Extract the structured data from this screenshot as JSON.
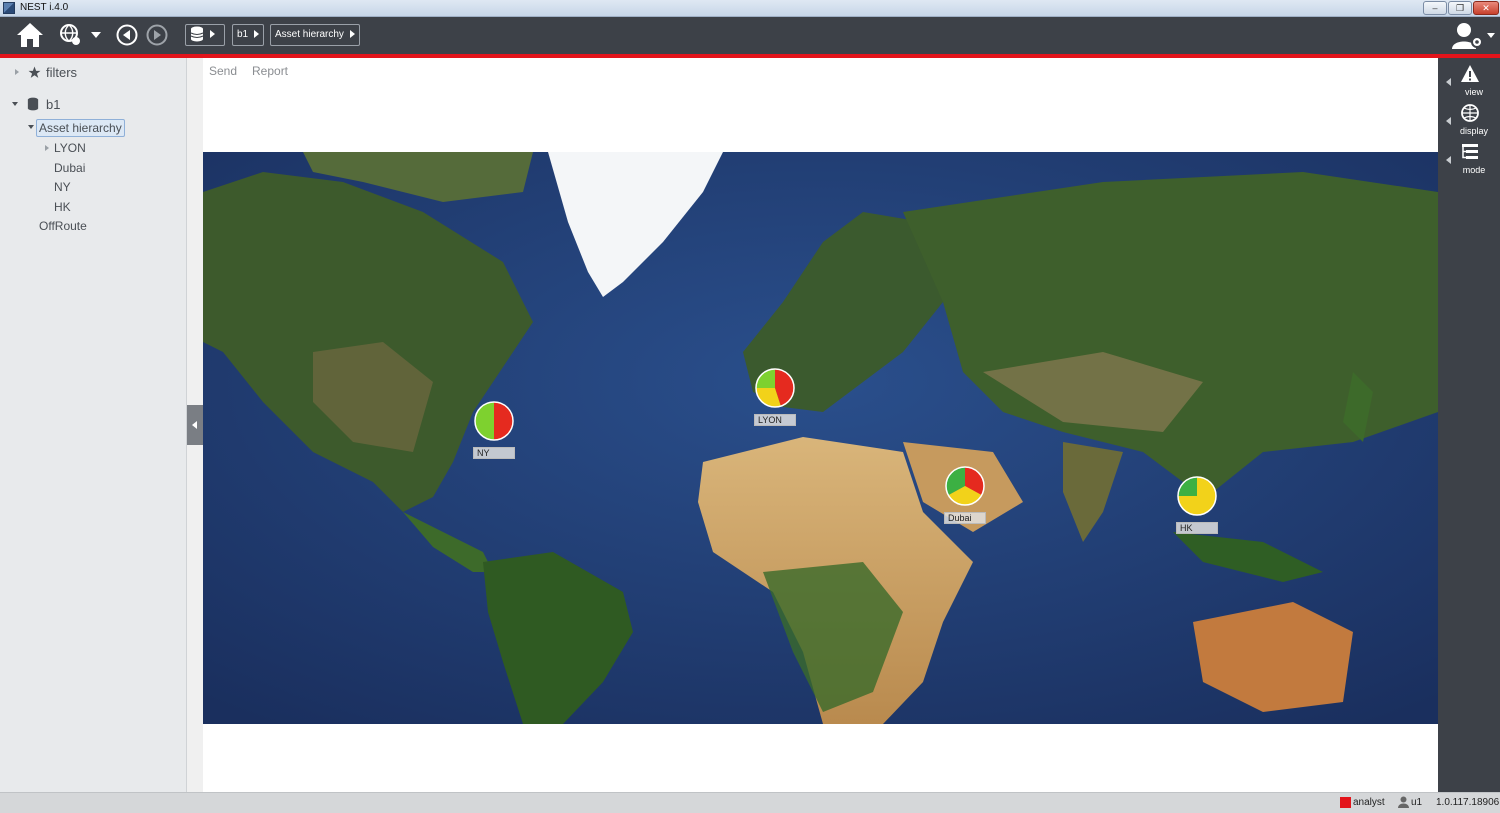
{
  "window": {
    "title": "NEST i.4.0"
  },
  "toolbar": {
    "breadcrumbs": [
      {
        "label": "b1"
      },
      {
        "label": "Asset hierarchy"
      }
    ]
  },
  "sidebar": {
    "filters_label": "filters",
    "root_label": "b1",
    "tree": {
      "selected": "Asset hierarchy",
      "children": [
        "LYON",
        "Dubai",
        "NY",
        "HK"
      ],
      "offroute": "OffRoute"
    }
  },
  "main": {
    "menu": [
      "Send",
      "Report"
    ]
  },
  "map": {
    "markers": [
      {
        "label": "NY",
        "slices": [
          {
            "color": "#e52a1f",
            "fraction": 0.5
          },
          {
            "color": "#7ed12f",
            "fraction": 0.5
          }
        ]
      },
      {
        "label": "LYON",
        "slices": [
          {
            "color": "#e52a1f",
            "fraction": 0.45
          },
          {
            "color": "#f2d21a",
            "fraction": 0.3
          },
          {
            "color": "#7ed12f",
            "fraction": 0.25
          }
        ]
      },
      {
        "label": "Dubai",
        "slices": [
          {
            "color": "#e52a1f",
            "fraction": 0.33
          },
          {
            "color": "#f2d21a",
            "fraction": 0.34
          },
          {
            "color": "#3cb043",
            "fraction": 0.33
          }
        ]
      },
      {
        "label": "HK",
        "slices": [
          {
            "color": "#f2d21a",
            "fraction": 0.75
          },
          {
            "color": "#3cb043",
            "fraction": 0.25
          }
        ]
      }
    ]
  },
  "rightbar": {
    "buttons": [
      {
        "label": "view"
      },
      {
        "label": "display"
      },
      {
        "label": "mode"
      }
    ]
  },
  "statusbar": {
    "role": "analyst",
    "user": "u1",
    "version": "1.0.117.18906"
  },
  "colors": {
    "accent": "#e3141b",
    "toolbar": "#3d4148"
  }
}
